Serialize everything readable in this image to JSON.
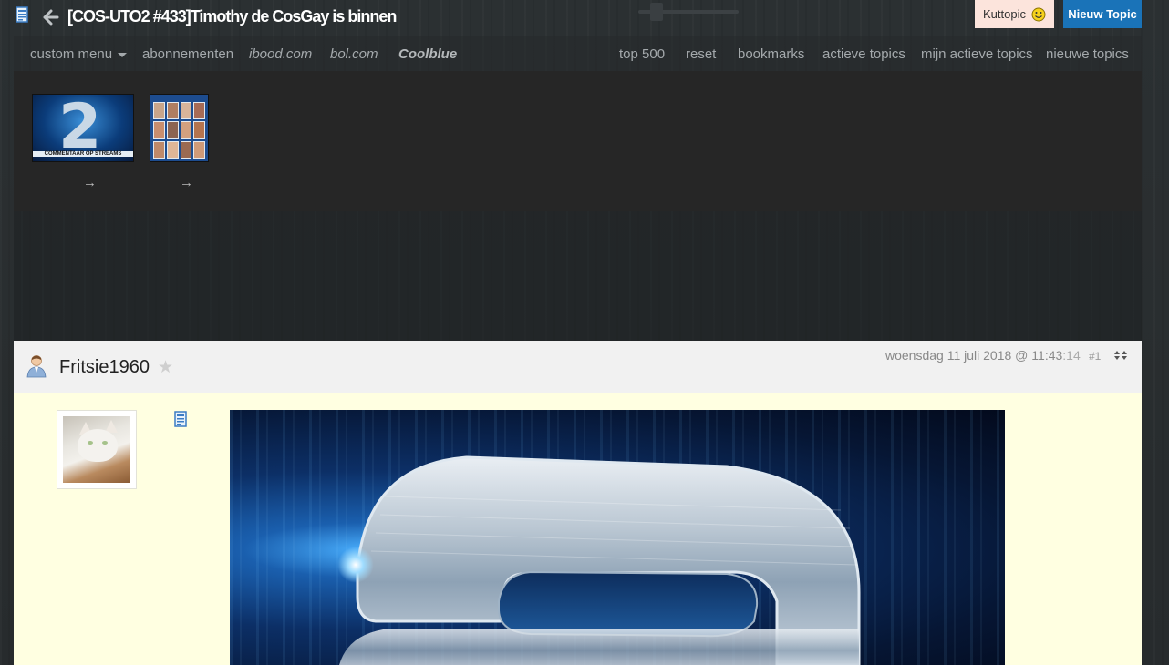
{
  "header": {
    "title": "[COS-UTO2 #433]Timothy de CosGay is binnen",
    "kuttopic_label": "Kuttopic",
    "new_topic_label": "Nieuw Topic"
  },
  "nav": {
    "custom_menu": "custom menu",
    "abonnementen": "abonnementen",
    "ibood": "ibood.com",
    "bol": "bol.com",
    "coolblue": "Coolblue",
    "top500": "top 500",
    "reset": "reset",
    "bookmarks": "bookmarks",
    "actieve_topics": "actieve topics",
    "mijn_actieve_topics": "mijn actieve topics",
    "nieuwe_topics": "nieuwe topics"
  },
  "thumbnails": {
    "thumb1_caption": "COMMENTAAR OP STREAMS",
    "thumb1_glyph": "2",
    "arrow": "→"
  },
  "post": {
    "username": "Fritsie1960",
    "star": "★",
    "date_main": "woensdag 11 juli 2018 @ 11:43",
    "date_seconds": ":14",
    "number": "#1"
  },
  "colors": {
    "new_topic_bg": "#1a73b8",
    "kuttopic_bg": "#fce4dc",
    "post_body_bg": "#ffffe1",
    "post_header_bg": "#f1f1f1"
  }
}
